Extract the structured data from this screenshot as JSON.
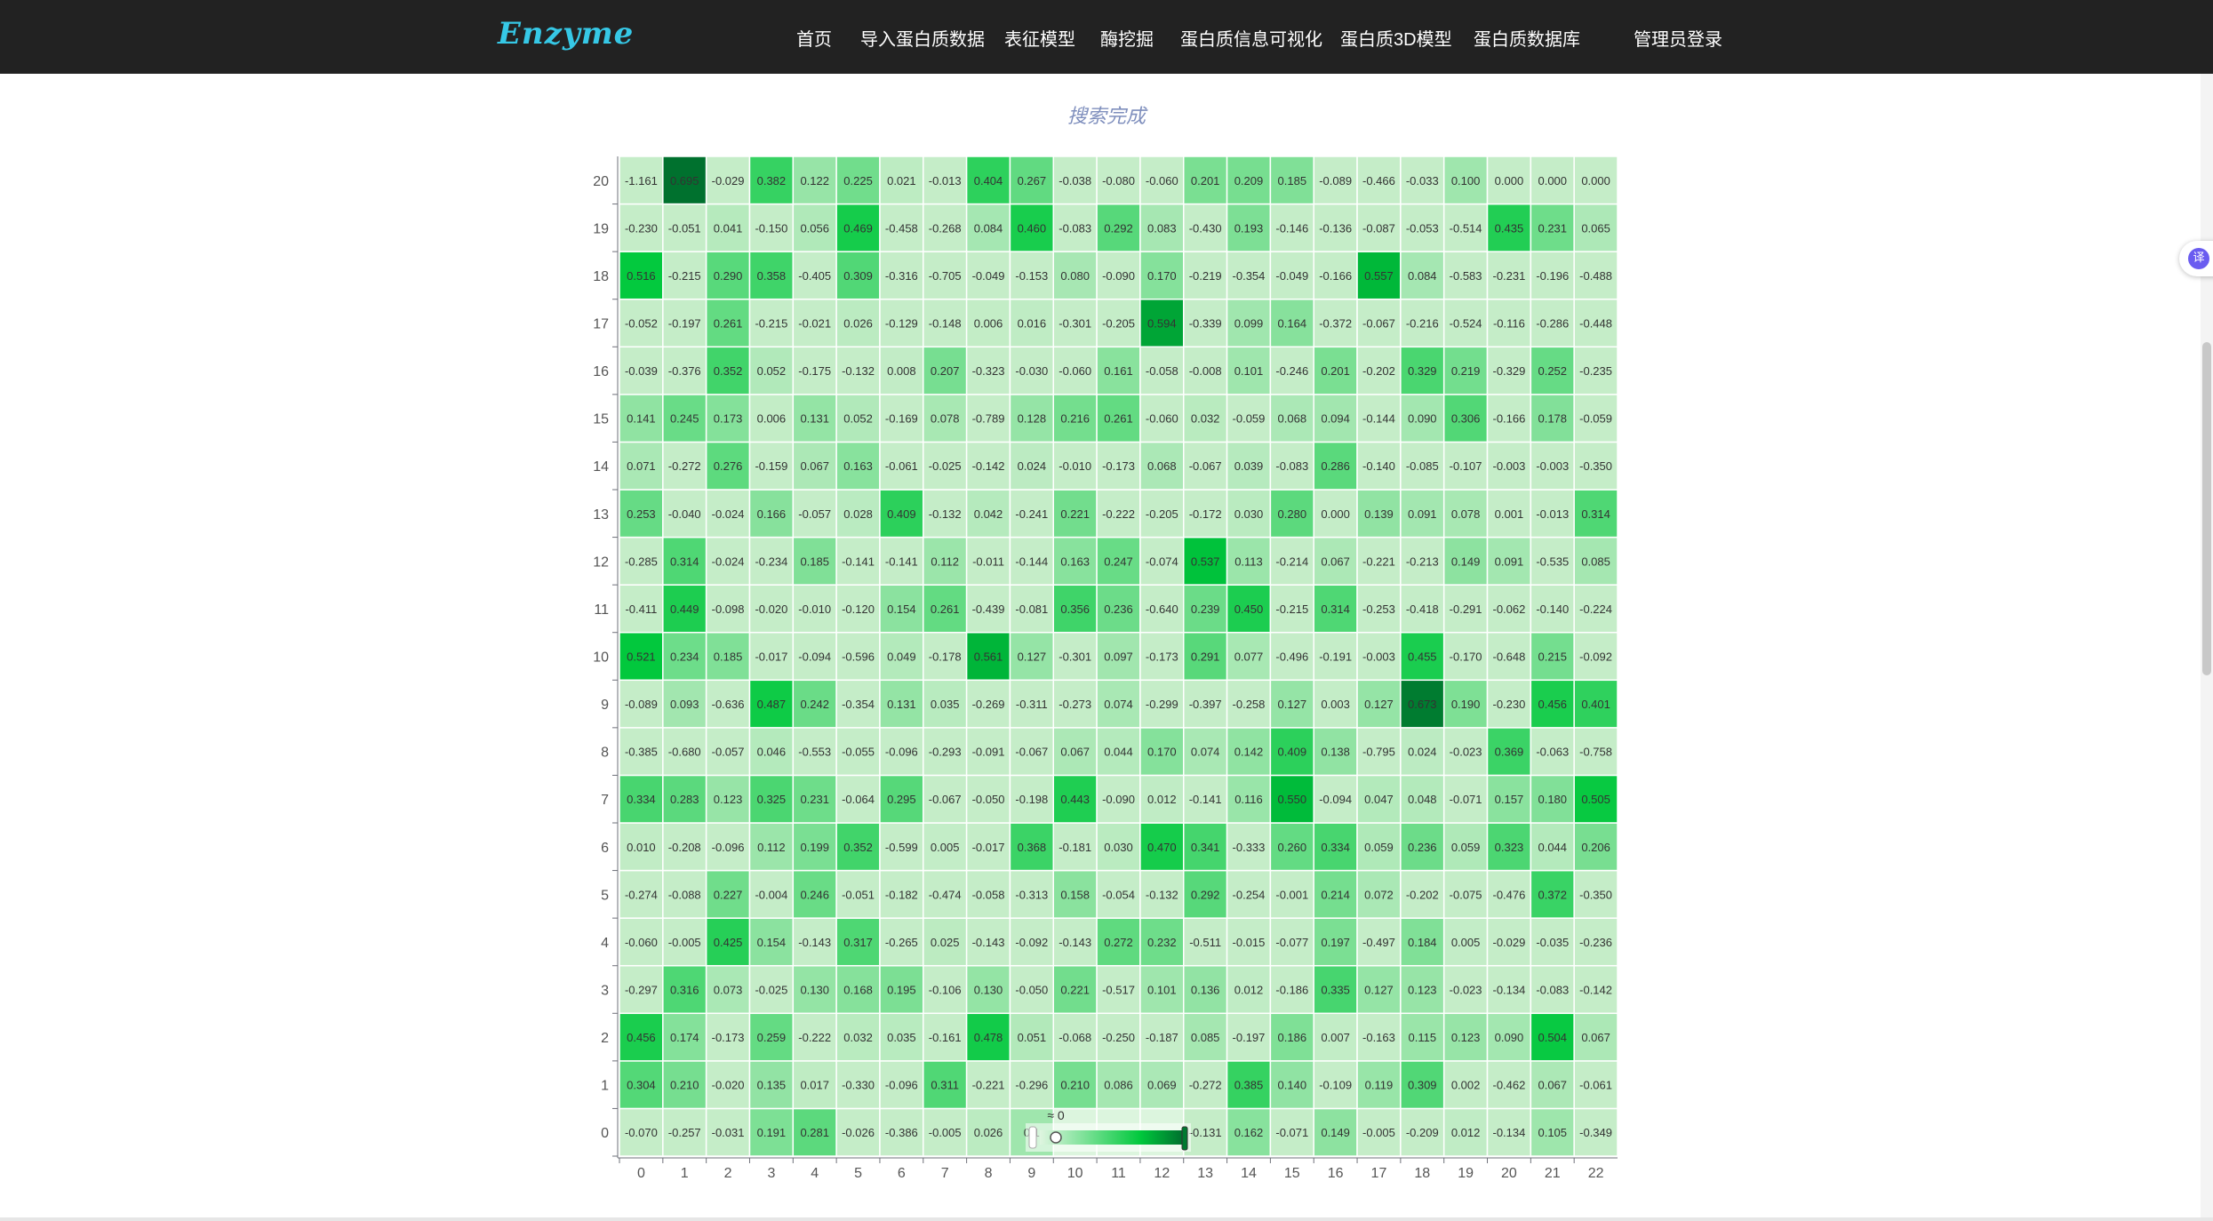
{
  "brand": "Enzyme",
  "nav": {
    "items": [
      "首页",
      "导入蛋白质数据",
      "表征模型",
      "酶挖掘",
      "蛋白质信息可视化",
      "蛋白质3D模型",
      "蛋白质数据库"
    ],
    "login": "管理员登录"
  },
  "status": "搜索完成",
  "colors": {
    "navbar": "#222222",
    "brand": "#36c8e6",
    "heat_low": "#c5edc8",
    "heat_high": "#006e2e"
  },
  "icons": {
    "translate": "译"
  },
  "chart_data": {
    "type": "heatmap",
    "x_labels": [
      "0",
      "1",
      "2",
      "3",
      "4",
      "5",
      "6",
      "7",
      "8",
      "9",
      "10",
      "11",
      "12",
      "13",
      "14",
      "15",
      "16",
      "17",
      "18",
      "19",
      "20",
      "21",
      "22"
    ],
    "y_labels": [
      "0",
      "1",
      "2",
      "3",
      "4",
      "5",
      "6",
      "7",
      "8",
      "9",
      "10",
      "11",
      "12",
      "13",
      "14",
      "15",
      "16",
      "17",
      "18",
      "19",
      "20"
    ],
    "rows": [
      [
        "-0.070",
        "-0.257",
        "-0.031",
        "0.191",
        "0.281",
        "-0.026",
        "-0.386",
        "-0.005",
        "0.026",
        "0.1",
        "",
        "",
        "",
        "-0.131",
        "0.162",
        "-0.071",
        "0.149",
        "-0.005",
        "-0.209",
        "0.012",
        "-0.134",
        "0.105",
        "-0.349"
      ],
      [
        "0.304",
        "0.210",
        "-0.020",
        "0.135",
        "0.017",
        "-0.330",
        "-0.096",
        "0.311",
        "-0.221",
        "-0.296",
        "0.210",
        "0.086",
        "0.069",
        "-0.272",
        "0.385",
        "0.140",
        "-0.109",
        "0.119",
        "0.309",
        "0.002",
        "-0.462",
        "0.067",
        "-0.061"
      ],
      [
        "0.456",
        "0.174",
        "-0.173",
        "0.259",
        "-0.222",
        "0.032",
        "0.035",
        "-0.161",
        "0.478",
        "0.051",
        "-0.068",
        "-0.250",
        "-0.187",
        "0.085",
        "-0.197",
        "0.186",
        "0.007",
        "-0.163",
        "0.115",
        "0.123",
        "0.090",
        "0.504",
        "0.067"
      ],
      [
        "-0.297",
        "0.316",
        "0.073",
        "-0.025",
        "0.130",
        "0.168",
        "0.195",
        "-0.106",
        "0.130",
        "-0.050",
        "0.221",
        "-0.517",
        "0.101",
        "0.136",
        "0.012",
        "-0.186",
        "0.335",
        "0.127",
        "0.123",
        "-0.023",
        "-0.134",
        "-0.083",
        "-0.142"
      ],
      [
        "-0.060",
        "-0.005",
        "0.425",
        "0.154",
        "-0.143",
        "0.317",
        "-0.265",
        "0.025",
        "-0.143",
        "-0.092",
        "-0.143",
        "0.272",
        "0.232",
        "-0.511",
        "-0.015",
        "-0.077",
        "0.197",
        "-0.497",
        "0.184",
        "0.005",
        "-0.029",
        "-0.035",
        "-0.236"
      ],
      [
        "-0.274",
        "-0.088",
        "0.227",
        "-0.004",
        "0.246",
        "-0.051",
        "-0.182",
        "-0.474",
        "-0.058",
        "-0.313",
        "0.158",
        "-0.054",
        "-0.132",
        "0.292",
        "-0.254",
        "-0.001",
        "0.214",
        "0.072",
        "-0.202",
        "-0.075",
        "-0.476",
        "0.372",
        "-0.350"
      ],
      [
        "0.010",
        "-0.208",
        "-0.096",
        "0.112",
        "0.199",
        "0.352",
        "-0.599",
        "0.005",
        "-0.017",
        "0.368",
        "-0.181",
        "0.030",
        "0.470",
        "0.341",
        "-0.333",
        "0.260",
        "0.334",
        "0.059",
        "0.236",
        "0.059",
        "0.323",
        "0.044",
        "0.206"
      ],
      [
        "0.334",
        "0.283",
        "0.123",
        "0.325",
        "0.231",
        "-0.064",
        "0.295",
        "-0.067",
        "-0.050",
        "-0.198",
        "0.443",
        "-0.090",
        "0.012",
        "-0.141",
        "0.116",
        "0.550",
        "-0.094",
        "0.047",
        "0.048",
        "-0.071",
        "0.157",
        "0.180",
        "0.505"
      ],
      [
        "-0.385",
        "-0.680",
        "-0.057",
        "0.046",
        "-0.553",
        "-0.055",
        "-0.096",
        "-0.293",
        "-0.091",
        "-0.067",
        "0.067",
        "0.044",
        "0.170",
        "0.074",
        "0.142",
        "0.409",
        "0.138",
        "-0.795",
        "0.024",
        "-0.023",
        "0.369",
        "-0.063",
        "-0.758"
      ],
      [
        "-0.089",
        "0.093",
        "-0.636",
        "0.487",
        "0.242",
        "-0.354",
        "0.131",
        "0.035",
        "-0.269",
        "-0.311",
        "-0.273",
        "0.074",
        "-0.299",
        "-0.397",
        "-0.258",
        "0.127",
        "0.003",
        "0.127",
        "0.673",
        "0.190",
        "-0.230",
        "0.456",
        "0.401"
      ],
      [
        "0.521",
        "0.234",
        "0.185",
        "-0.017",
        "-0.094",
        "-0.596",
        "0.049",
        "-0.178",
        "0.561",
        "0.127",
        "-0.301",
        "0.097",
        "-0.173",
        "0.291",
        "0.077",
        "-0.496",
        "-0.191",
        "-0.003",
        "0.455",
        "-0.170",
        "-0.648",
        "0.215",
        "-0.092"
      ],
      [
        "-0.411",
        "0.449",
        "-0.098",
        "-0.020",
        "-0.010",
        "-0.120",
        "0.154",
        "0.261",
        "-0.439",
        "-0.081",
        "0.356",
        "0.236",
        "-0.640",
        "0.239",
        "0.450",
        "-0.215",
        "0.314",
        "-0.253",
        "-0.418",
        "-0.291",
        "-0.062",
        "-0.140",
        "-0.224"
      ],
      [
        "-0.285",
        "0.314",
        "-0.024",
        "-0.234",
        "0.185",
        "-0.141",
        "-0.141",
        "0.112",
        "-0.011",
        "-0.144",
        "0.163",
        "0.247",
        "-0.074",
        "0.537",
        "0.113",
        "-0.214",
        "0.067",
        "-0.221",
        "-0.213",
        "0.149",
        "0.091",
        "-0.535",
        "0.085"
      ],
      [
        "0.253",
        "-0.040",
        "-0.024",
        "0.166",
        "-0.057",
        "0.028",
        "0.409",
        "-0.132",
        "0.042",
        "-0.241",
        "0.221",
        "-0.222",
        "-0.205",
        "-0.172",
        "0.030",
        "0.280",
        "0.000",
        "0.139",
        "0.091",
        "0.078",
        "0.001",
        "-0.013",
        "0.314"
      ],
      [
        "0.071",
        "-0.272",
        "0.276",
        "-0.159",
        "0.067",
        "0.163",
        "-0.061",
        "-0.025",
        "-0.142",
        "0.024",
        "-0.010",
        "-0.173",
        "0.068",
        "-0.067",
        "0.039",
        "-0.083",
        "0.286",
        "-0.140",
        "-0.085",
        "-0.107",
        "-0.003",
        "-0.003",
        "-0.350"
      ],
      [
        "0.141",
        "0.245",
        "0.173",
        "0.006",
        "0.131",
        "0.052",
        "-0.169",
        "0.078",
        "-0.789",
        "0.128",
        "0.216",
        "0.261",
        "-0.060",
        "0.032",
        "-0.059",
        "0.068",
        "0.094",
        "-0.144",
        "0.090",
        "0.306",
        "-0.166",
        "0.178",
        "-0.059"
      ],
      [
        "-0.039",
        "-0.376",
        "0.352",
        "0.052",
        "-0.175",
        "-0.132",
        "0.008",
        "0.207",
        "-0.323",
        "-0.030",
        "-0.060",
        "0.161",
        "-0.058",
        "-0.008",
        "0.101",
        "-0.246",
        "0.201",
        "-0.202",
        "0.329",
        "0.219",
        "-0.329",
        "0.252",
        "-0.235"
      ],
      [
        "-0.052",
        "-0.197",
        "0.261",
        "-0.215",
        "-0.021",
        "0.026",
        "-0.129",
        "-0.148",
        "0.006",
        "0.016",
        "-0.301",
        "-0.205",
        "0.594",
        "-0.339",
        "0.099",
        "0.164",
        "-0.372",
        "-0.067",
        "-0.216",
        "-0.524",
        "-0.116",
        "-0.286",
        "-0.448"
      ],
      [
        "0.516",
        "-0.215",
        "0.290",
        "0.358",
        "-0.405",
        "0.309",
        "-0.316",
        "-0.705",
        "-0.049",
        "-0.153",
        "0.080",
        "-0.090",
        "0.170",
        "-0.219",
        "-0.354",
        "-0.049",
        "-0.166",
        "0.557",
        "0.084",
        "-0.583",
        "-0.231",
        "-0.196",
        "-0.488"
      ],
      [
        "-0.230",
        "-0.051",
        "0.041",
        "-0.150",
        "0.056",
        "0.469",
        "-0.458",
        "-0.268",
        "0.084",
        "0.460",
        "-0.083",
        "0.292",
        "0.083",
        "-0.430",
        "0.193",
        "-0.146",
        "-0.136",
        "-0.087",
        "-0.053",
        "-0.514",
        "0.435",
        "0.231",
        "0.065"
      ],
      [
        "-1.161",
        "0.695",
        "-0.029",
        "0.382",
        "0.122",
        "0.225",
        "0.021",
        "-0.013",
        "0.404",
        "0.267",
        "-0.038",
        "-0.080",
        "-0.060",
        "0.201",
        "0.209",
        "0.185",
        "-0.089",
        "-0.466",
        "-0.033",
        "0.100",
        "0.000",
        "0.000",
        "0.000"
      ]
    ],
    "color_range": [
      0,
      0.7
    ],
    "visual_map_label": "≈ 0",
    "grid": true,
    "legend": "bottom-center"
  }
}
